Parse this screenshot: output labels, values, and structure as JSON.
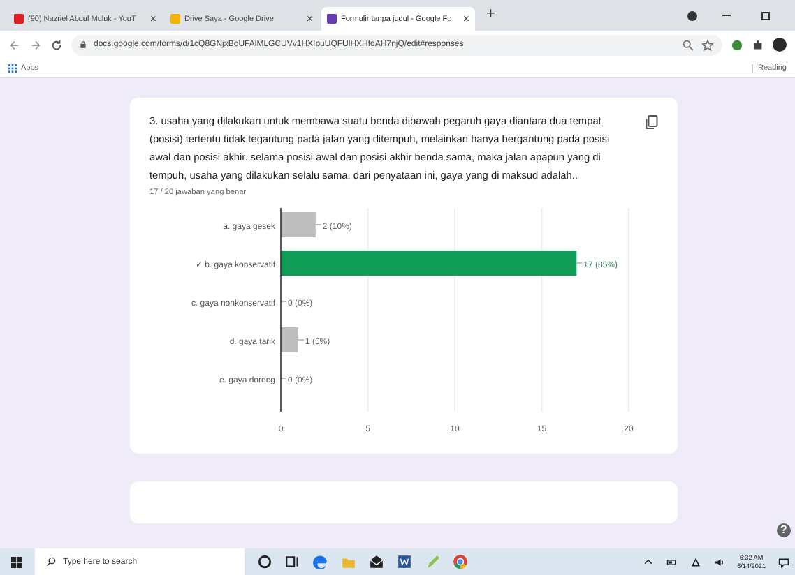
{
  "browser": {
    "tabs": [
      {
        "title": "(90) Nazriel Abdul Muluk - YouT",
        "selected": false,
        "close": "×"
      },
      {
        "title": "Drive Saya - Google Drive",
        "selected": false,
        "close": "×"
      },
      {
        "title": "Formulir tanpa judul - Google Fo",
        "selected": true,
        "close": "×"
      }
    ],
    "new_tab": "+",
    "url": "docs.google.com/forms/d/1cQ8GNjxBoUFAlMLGCUVv1HXIpuUQFUlHXHfdAH7njQ/edit#responses",
    "bookmarks": [
      {
        "label": "Apps"
      }
    ],
    "reading_list": "Reading"
  },
  "question": {
    "text": "3. usaha yang dilakukan untuk membawa suatu benda dibawah pegaruh gaya diantara dua tempat (posisi) tertentu tidak tegantung pada jalan yang ditempuh, melainkan hanya bergantung pada posisi awal dan posisi akhir. selama posisi awal dan posisi akhir benda sama, maka jalan apapun yang di tempuh, usaha yang dilakukan selalu sama. dari penyataan ini, gaya yang di maksud adalah..",
    "score": "17 / 20 jawaban yang benar",
    "options": [
      {
        "correct": false
      },
      {
        "correct": true
      },
      {
        "correct": false
      },
      {
        "correct": false
      },
      {
        "correct": false
      }
    ],
    "chart_data": {
      "type": "bar",
      "orientation": "horizontal",
      "grid": true,
      "categories": [
        "a. gaya gesek",
        "✓ b. gaya konservatif",
        "c. gaya nonkonservatif",
        "d. gaya tarik",
        "e. gaya dorong"
      ],
      "values": [
        2,
        17,
        0,
        1,
        0
      ],
      "xlim": [
        0,
        20
      ],
      "xticks": [
        0,
        5,
        10,
        15,
        20
      ],
      "value_labels": [
        "2 (10%)",
        "17 (85%)",
        "0 (0%)",
        "1 (5%)",
        "0 (0%)"
      ]
    }
  },
  "help": "?",
  "taskbar": {
    "search_placeholder": "Type here to search",
    "time": "6:32 AM",
    "date": "6/14/2021"
  }
}
